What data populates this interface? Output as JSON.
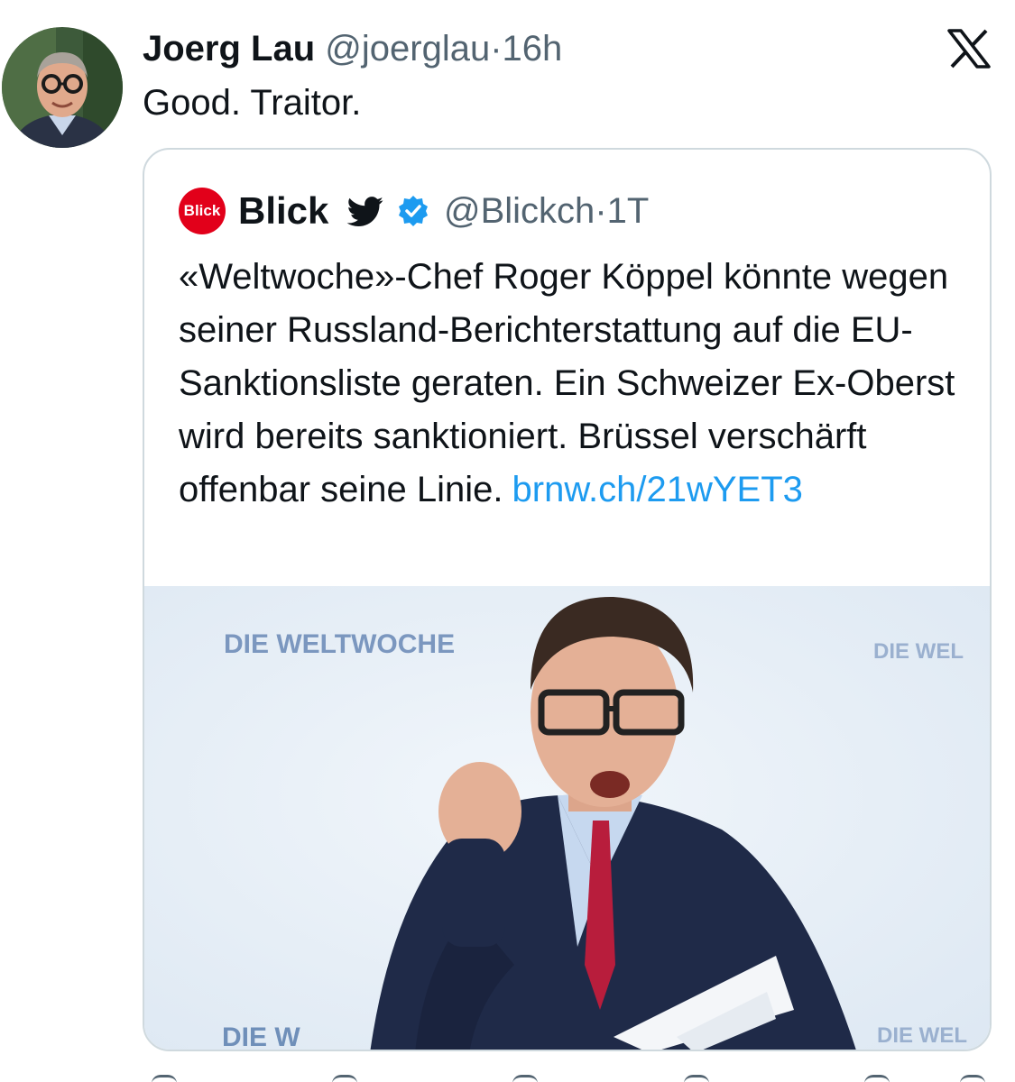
{
  "author": {
    "display_name": "Joerg Lau",
    "handle": "@joerglau",
    "separator": "·",
    "time": "16h"
  },
  "platform_icon": "x-logo-icon",
  "tweet": {
    "text": "Good. Traitor."
  },
  "quoted_tweet": {
    "logo_text": "Blick",
    "display_name": "Blick",
    "handle": "@Blickch",
    "separator": "·",
    "time": "1T",
    "text": "«Weltwoche»-Chef Roger Köppel könnte wegen seiner Russland-Berichterstattung auf die EU-Sanktionsliste geraten. Ein Schweizer Ex-Oberst wird bereits sanktioniert. Brüssel verschärft offenbar seine Linie.",
    "link": "brnw.ch/21wYET3",
    "image": {
      "backdrop_text_left": "DIE WELTWOCHE",
      "backdrop_text_right": "DIE WEL",
      "backdrop_text_bottom_left": "DIE W",
      "backdrop_text_bottom_right": "DIE WEL"
    }
  },
  "colors": {
    "link": "#1d9bf0",
    "verified": "#1d9bf0",
    "blick_red": "#e2001a",
    "text_primary": "#0f1419",
    "text_secondary": "#536471",
    "border": "#cfd9de"
  },
  "actions": [
    "reply-icon",
    "retweet-icon",
    "like-icon",
    "views-icon",
    "bookmark-icon",
    "share-icon"
  ]
}
